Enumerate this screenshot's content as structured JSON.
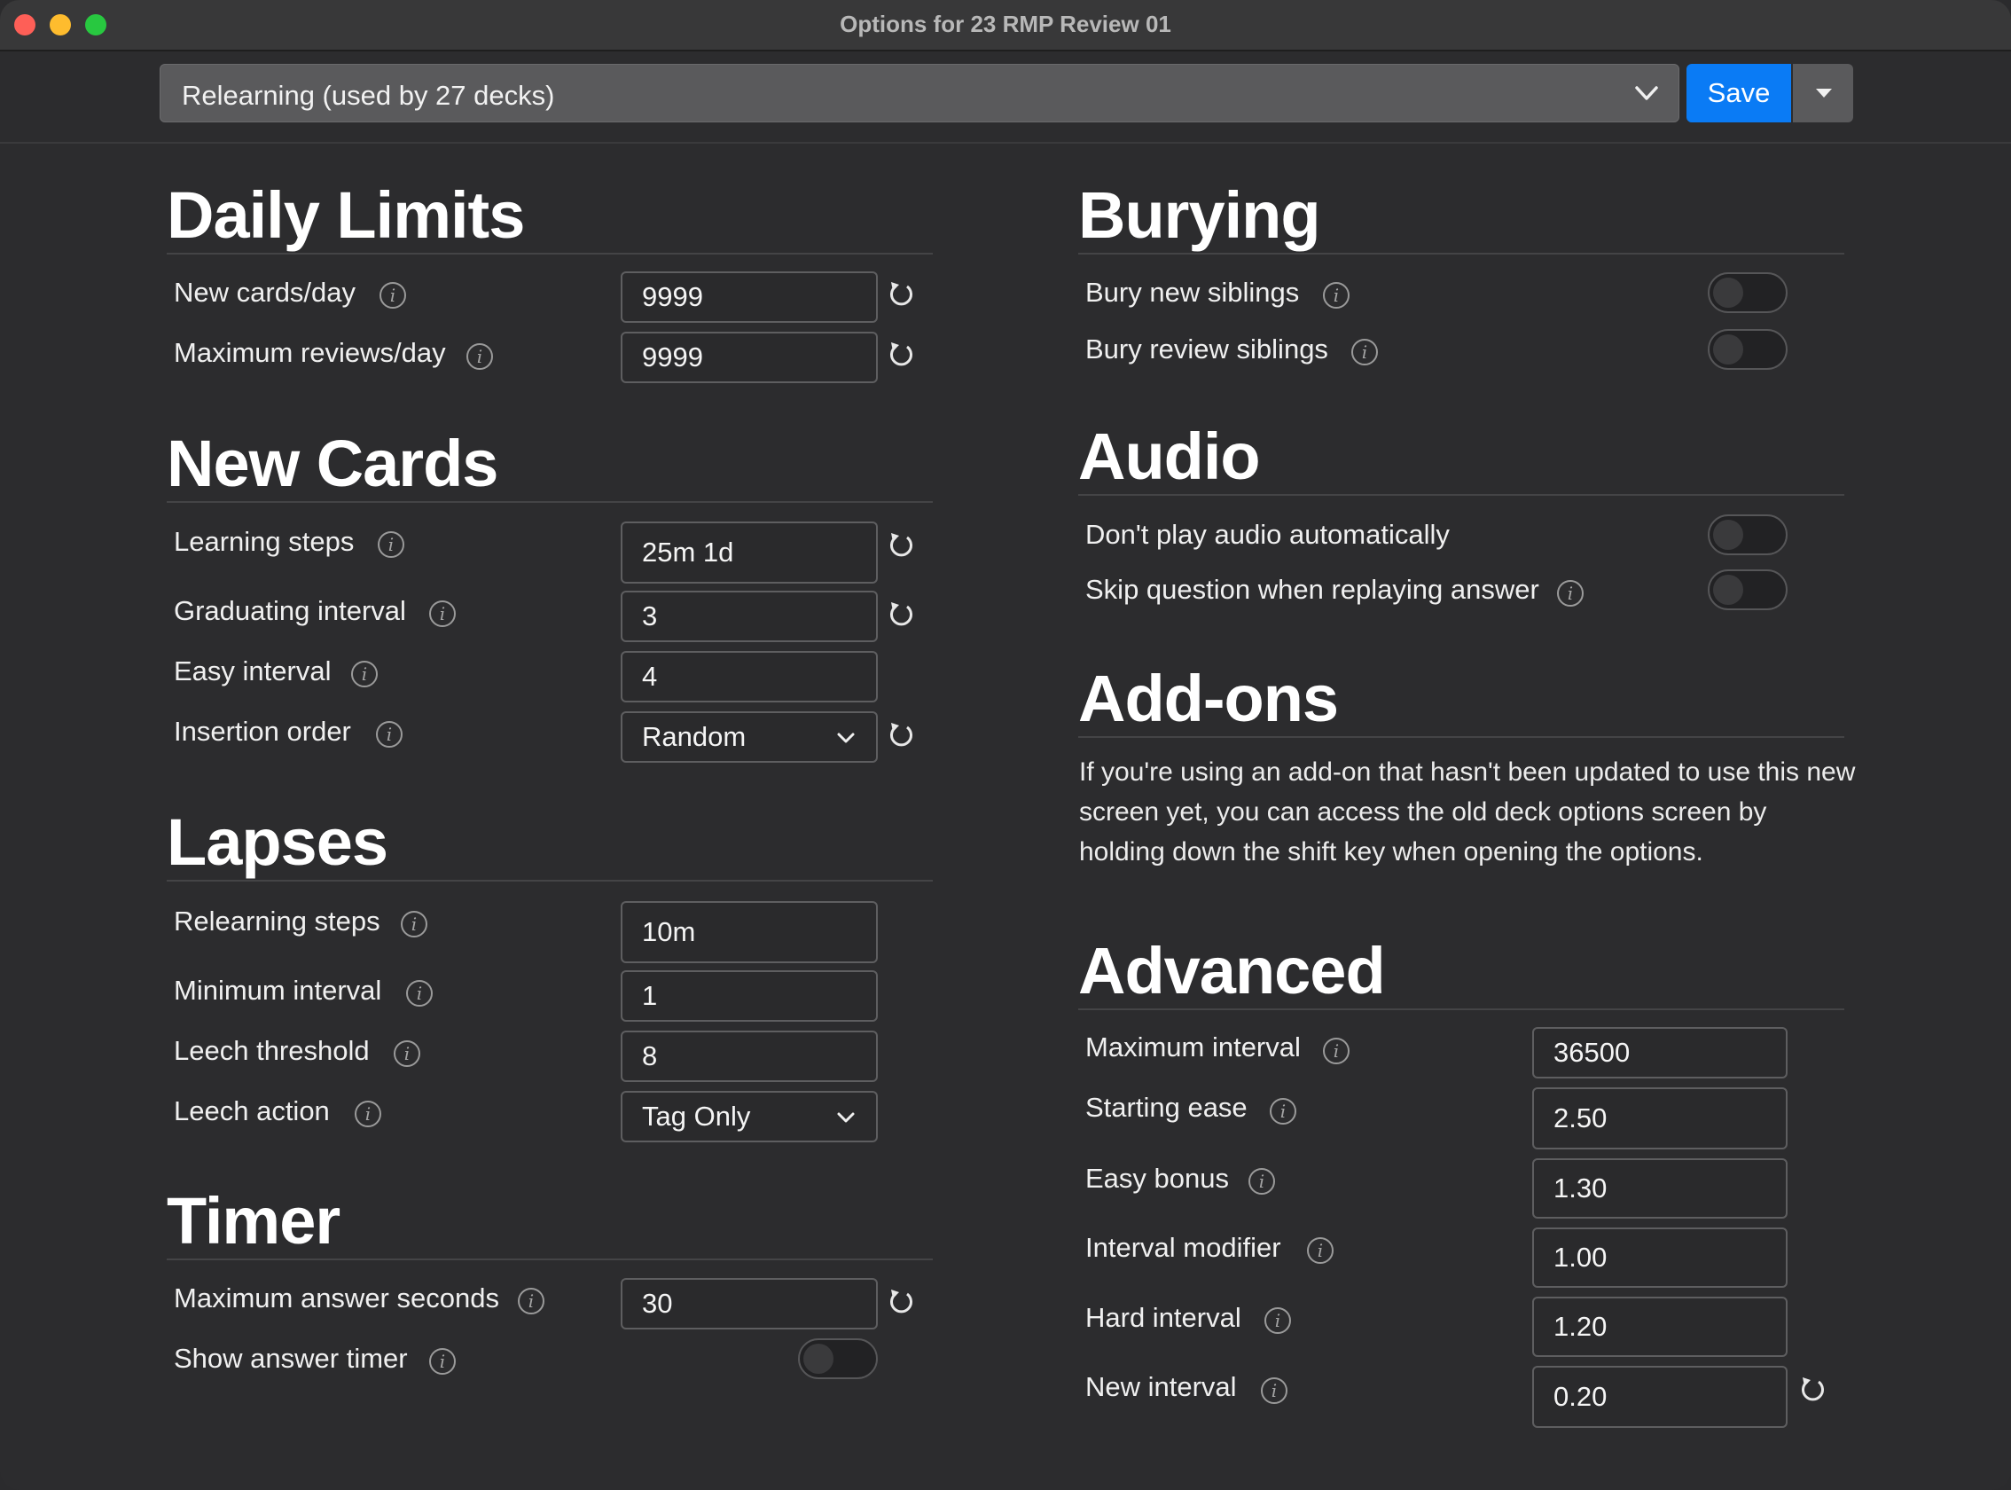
{
  "window": {
    "title": "Options for 23 RMP Review 01"
  },
  "topbar": {
    "preset": "Relearning (used by 27 decks)",
    "save_label": "Save"
  },
  "daily_limits": {
    "title": "Daily Limits",
    "new_cards_label": "New cards/day",
    "new_cards_value": "9999",
    "max_reviews_label": "Maximum reviews/day",
    "max_reviews_value": "9999"
  },
  "new_cards": {
    "title": "New Cards",
    "learning_steps_label": "Learning steps",
    "learning_steps_value": "25m 1d",
    "graduating_label": "Graduating interval",
    "graduating_value": "3",
    "easy_label": "Easy interval",
    "easy_value": "4",
    "insertion_label": "Insertion order",
    "insertion_value": "Random"
  },
  "lapses": {
    "title": "Lapses",
    "relearning_label": "Relearning steps",
    "relearning_value": "10m",
    "min_interval_label": "Minimum interval",
    "min_interval_value": "1",
    "leech_threshold_label": "Leech threshold",
    "leech_threshold_value": "8",
    "leech_action_label": "Leech action",
    "leech_action_value": "Tag Only"
  },
  "timer": {
    "title": "Timer",
    "max_answer_label": "Maximum answer seconds",
    "max_answer_value": "30",
    "show_timer_label": "Show answer timer",
    "show_timer_on": false
  },
  "burying": {
    "title": "Burying",
    "bury_new_label": "Bury new siblings",
    "bury_new_on": false,
    "bury_review_label": "Bury review siblings",
    "bury_review_on": false
  },
  "audio": {
    "title": "Audio",
    "no_autoplay_label": "Don't play audio automatically",
    "no_autoplay_on": false,
    "skip_question_label": "Skip question when replaying answer",
    "skip_question_on": false
  },
  "addons": {
    "title": "Add-ons",
    "text": "If you're using an add-on that hasn't been updated to use this new screen yet, you can access the old deck options screen by holding down the shift key when opening the options."
  },
  "advanced": {
    "title": "Advanced",
    "max_interval_label": "Maximum interval",
    "max_interval_value": "36500",
    "starting_ease_label": "Starting ease",
    "starting_ease_value": "2.50",
    "easy_bonus_label": "Easy bonus",
    "easy_bonus_value": "1.30",
    "interval_modifier_label": "Interval modifier",
    "interval_modifier_value": "1.00",
    "hard_interval_label": "Hard interval",
    "hard_interval_value": "1.20",
    "new_interval_label": "New interval",
    "new_interval_value": "0.20"
  },
  "icons": {
    "info": "info-icon",
    "reset": "reset-icon",
    "chevron": "chevron-down-icon"
  },
  "colors": {
    "accent": "#0a7bf5",
    "background": "#2c2c2e"
  }
}
